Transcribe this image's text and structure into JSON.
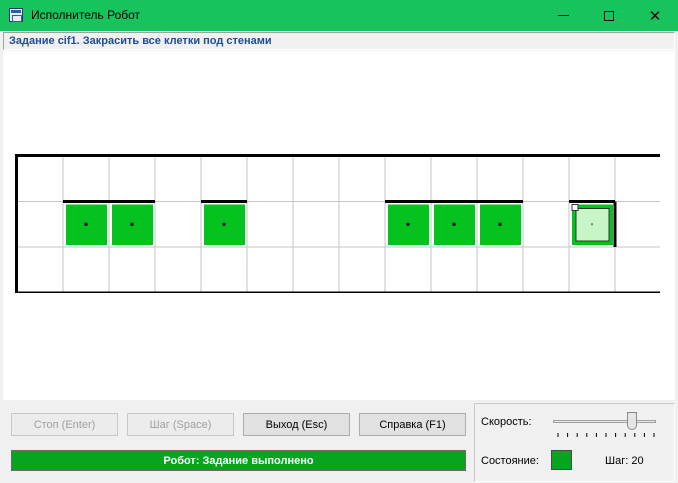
{
  "window": {
    "title": "Исполнитель Робот",
    "controls": [
      "minimize-icon",
      "maximize-icon",
      "close-icon"
    ]
  },
  "task": {
    "label": "Задание cif1. Закрасить все клетки под стенами"
  },
  "field": {
    "rows": 3,
    "cols": 14,
    "painted_cells": [
      {
        "row": 2,
        "col": 2
      },
      {
        "row": 2,
        "col": 3
      },
      {
        "row": 2,
        "col": 5
      },
      {
        "row": 2,
        "col": 9
      },
      {
        "row": 2,
        "col": 10
      },
      {
        "row": 2,
        "col": 11
      },
      {
        "row": 2,
        "col": 13
      }
    ],
    "horizontal_walls_above_row2": [
      {
        "col_start": 2,
        "col_end": 3
      },
      {
        "col_start": 5,
        "col_end": 5
      },
      {
        "col_start": 9,
        "col_end": 11
      },
      {
        "col_start": 13,
        "col_end": 13
      }
    ],
    "vertical_walls_right_of": [
      {
        "row": 2,
        "col": 13
      }
    ],
    "robot": {
      "row": 2,
      "col": 13
    },
    "colors": {
      "painted": "#06c21f",
      "robot_cell": "#c8f5c8",
      "grid": "#c6c6c6",
      "wall": "#000000"
    }
  },
  "buttons": {
    "stop": "Стоп (Enter)",
    "step": "Шаг (Space)",
    "exit": "Выход (Esc)",
    "help": "Справка (F1)"
  },
  "status": {
    "text": "Робот: Задание выполнено",
    "color": "#06a520"
  },
  "speed": {
    "label": "Скорость:",
    "level_fraction": 0.8
  },
  "state": {
    "label": "Состояние:",
    "color": "#06a520"
  },
  "step": {
    "label": "Шаг:",
    "count": "20"
  }
}
